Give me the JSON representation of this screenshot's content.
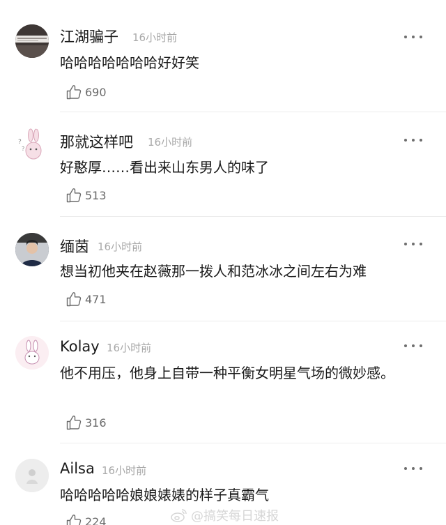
{
  "comments": [
    {
      "username": "江湖骗子",
      "time": "16小时前",
      "text": "哈哈哈哈哈哈哈好好笑",
      "likes": "690",
      "avatar_icon": "photo-avatar-icon"
    },
    {
      "username": "那就这样吧",
      "time": "16小时前",
      "text": "好憨厚……看出来山东男人的味了",
      "likes": "513",
      "avatar_icon": "bunny-avatar-icon"
    },
    {
      "username": "缅茵",
      "time": "16小时前",
      "text": "想当初他夹在赵薇那一拨人和范冰冰之间左右为难",
      "likes": "471",
      "avatar_icon": "person-avatar-icon"
    },
    {
      "username": "Kolay",
      "time": "16小时前",
      "text": "他不用压，他身上自带一种平衡女明星气场的微妙感。",
      "likes": "316",
      "avatar_icon": "bunny-avatar-icon"
    },
    {
      "username": "Ailsa",
      "time": "16小时前",
      "text": "哈哈哈哈哈娘娘婊婊的样子真霸气",
      "likes": "224",
      "avatar_icon": "figure-avatar-icon"
    }
  ],
  "watermark": {
    "text": "@搞笑每日速报",
    "icon": "weibo-logo-icon"
  },
  "colors": {
    "text": "#1a1a1a",
    "timestamp": "#a8a8a8",
    "like_count": "#6a6a6a",
    "divider": "#ececec"
  }
}
